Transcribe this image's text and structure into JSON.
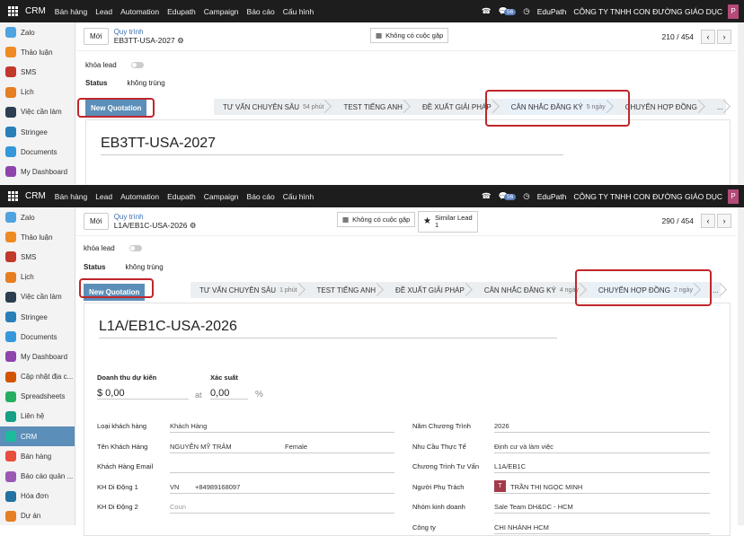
{
  "topbar": {
    "brand": "CRM",
    "menu": [
      "Bán hàng",
      "Lead",
      "Automation",
      "Edupath",
      "Campaign",
      "Báo cáo",
      "Cấu hình"
    ],
    "badge": "56",
    "app": "EduPath",
    "company": "CÔNG TY TNHH CON ĐƯỜNG GIÁO DỤC",
    "avatar": "P"
  },
  "sidebar_top": [
    "Zalo",
    "Thảo luận",
    "SMS",
    "Lịch",
    "Việc cần làm",
    "Stringee",
    "Documents",
    "My Dashboard"
  ],
  "sidebar_bottom": [
    "Zalo",
    "Thảo luận",
    "SMS",
    "Lịch",
    "Việc cần làm",
    "Stringee",
    "Documents",
    "My Dashboard",
    "Cập nhật địa c...",
    "Spreadsheets",
    "Liên hệ",
    "CRM",
    "Bán hàng",
    "Báo cáo quản ...",
    "Hóa đơn",
    "Dự án"
  ],
  "sidebar_colors": [
    "#4fa3e0",
    "#f08a24",
    "#c0392b",
    "#e67e22",
    "#2c3e50",
    "#2980b9",
    "#3498db",
    "#8e44ad",
    "#d35400",
    "#27ae60",
    "#16a085",
    "#1abc9c",
    "#e74c3c",
    "#9b59b6",
    "#2471a3",
    "#e67e22"
  ],
  "top_record": {
    "btn_new": "Mới",
    "crumb_parent": "Quy trình",
    "crumb_current": "EB3TT-USA-2027",
    "meetings": "Không có cuộc gặp",
    "pager": "210 / 454",
    "lock_label": "khóa lead",
    "status_label": "Status",
    "status_value": "không trùng",
    "new_quotation": "New Quotation",
    "stages": [
      {
        "label": "TƯ VẤN CHUYÊN SÂU",
        "dur": "54 phút"
      },
      {
        "label": "TEST TIẾNG ANH",
        "dur": ""
      },
      {
        "label": "ĐỀ XUẤT GIẢI PHÁP",
        "dur": ""
      },
      {
        "label": "CÂN NHẮC ĐĂNG KÝ",
        "dur": "5 ngày"
      },
      {
        "label": "CHUYỂN HỢP ĐỒNG",
        "dur": ""
      }
    ],
    "more": "...",
    "title": "EB3TT-USA-2027"
  },
  "bottom_record": {
    "btn_new": "Mới",
    "crumb_parent": "Quy trình",
    "crumb_current": "L1A/EB1C-USA-2026",
    "meetings": "Không có cuộc gặp",
    "similar": "Similar Lead",
    "similar_count": "1",
    "pager": "290 / 454",
    "lock_label": "khóa lead",
    "status_label": "Status",
    "status_value": "không trùng",
    "new_quotation": "New Quotation",
    "stages": [
      {
        "label": "TƯ VẤN CHUYÊN SÂU",
        "dur": "1 phút"
      },
      {
        "label": "TEST TIẾNG ANH",
        "dur": ""
      },
      {
        "label": "ĐỀ XUẤT GIẢI PHÁP",
        "dur": ""
      },
      {
        "label": "CÂN NHẮC ĐĂNG KÝ",
        "dur": "4 ngày"
      },
      {
        "label": "CHUYỂN HỢP ĐỒNG",
        "dur": "2 ngày"
      }
    ],
    "more": "...",
    "title": "L1A/EB1C-USA-2026",
    "revenue_label": "Doanh thu dự kiến",
    "revenue": "$ 0,00",
    "at": "at",
    "prob_label": "Xác suất",
    "prob": "0,00",
    "pct": "%",
    "fields_left": [
      {
        "label": "Loại khách hàng",
        "value": "Khách Hàng"
      },
      {
        "label": "Tên Khách Hàng",
        "value": "NGUYỄN MỸ TRÂM",
        "extra": "Female"
      },
      {
        "label": "Khách Hàng Email",
        "value": ""
      },
      {
        "label": "KH Di Động 1",
        "value": "+84989168097",
        "prefix": "VN"
      },
      {
        "label": "KH Di Động 2",
        "value": "",
        "prefix": "Coun"
      }
    ],
    "fields_right": [
      {
        "label": "Năm Chương Trình",
        "value": "2026"
      },
      {
        "label": "Nhu Cầu Thực Tế",
        "value": "Định cư và làm việc"
      },
      {
        "label": "Chương Trình Tư Vấn",
        "value": "L1A/EB1C"
      },
      {
        "label": "Người Phụ Trách",
        "value": "TRẦN THỊ NGỌC MINH",
        "avatar": "T"
      },
      {
        "label": "Nhóm kinh doanh",
        "value": "Sale Team DH&DC - HCM"
      },
      {
        "label": "Công ty",
        "value": "CHI NHÁNH HCM"
      }
    ]
  }
}
